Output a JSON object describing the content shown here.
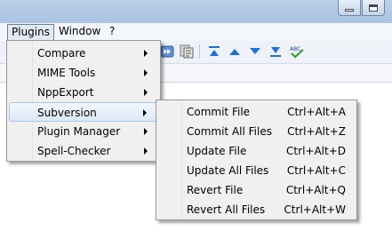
{
  "window": {
    "minimize_icon": "minimize-icon",
    "maximize_icon": "maximize-icon"
  },
  "menubar": {
    "items": [
      {
        "label": "Plugins",
        "open": true
      },
      {
        "label": "Window"
      },
      {
        "label": "?"
      }
    ]
  },
  "toolbar": {
    "icons": [
      "forward-icon",
      "macro-list-icon",
      "compare-first-icon",
      "compare-previous-icon",
      "compare-next-icon",
      "compare-last-icon",
      "spell-check-abc-icon"
    ],
    "spell_text": "ABC"
  },
  "plugins_menu": {
    "items": [
      {
        "label": "Compare",
        "submenu": true
      },
      {
        "label": "MIME Tools",
        "submenu": true
      },
      {
        "label": "NppExport",
        "submenu": true
      },
      {
        "label": "Subversion",
        "submenu": true,
        "highlighted": true
      },
      {
        "label": "Plugin Manager",
        "submenu": true
      },
      {
        "label": "Spell-Checker",
        "submenu": true
      }
    ]
  },
  "subversion_menu": {
    "items": [
      {
        "label": "Commit File",
        "shortcut": "Ctrl+Alt+A"
      },
      {
        "label": "Commit All Files",
        "shortcut": "Ctrl+Alt+Z"
      },
      {
        "label": "Update File",
        "shortcut": "Ctrl+Alt+D"
      },
      {
        "label": "Update All Files",
        "shortcut": "Ctrl+Alt+C"
      },
      {
        "label": "Revert File",
        "shortcut": "Ctrl+Alt+Q"
      },
      {
        "label": "Revert All Files",
        "shortcut": "Ctrl+Alt+W"
      }
    ]
  },
  "colors": {
    "highlight_border": "#a9c5e8",
    "menu_background": "#f0f0f0",
    "toolbar_arrow_blue": "#1e6fd9"
  }
}
